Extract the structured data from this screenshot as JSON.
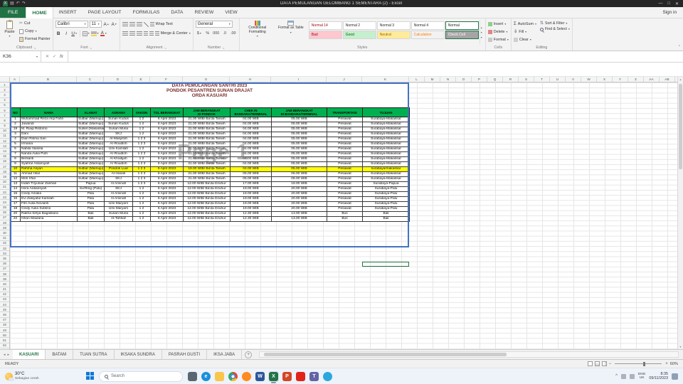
{
  "colors": {
    "excel_green": "#217346",
    "table_header_green": "#00b050",
    "row_highlight": "#ffff00",
    "page_break_blue": "#4472c4",
    "title_text": "#7b2c2c",
    "taskbar_bg": "#eef2f9"
  },
  "glyphs": {
    "dropdown": "▾",
    "up": "▴",
    "bold": "B",
    "italic": "I",
    "underline": "U",
    "sigma": "Σ",
    "cut_icon": "✂",
    "check": "✓",
    "cross": "✕",
    "chevron_up": "^",
    "tab_left": "◂",
    "tab_right": "▸",
    "plus": "+",
    "minus": "−",
    "font_a": "A",
    "add_sheet": "+",
    "dialog_launcher": "↘",
    "sort": "⇅",
    "fill_arrow": "⇓",
    "minimize": "—",
    "maximize": "□",
    "undo": "↶",
    "redo": "↷",
    "save": "▤"
  },
  "window": {
    "title": "DATA PEMULANGAN GELOMBANG 1 SEMENTARA (2) - Excel",
    "sign_in": "Sign in",
    "logo_letter": "X"
  },
  "ribbon": {
    "tabs": [
      {
        "label": "FILE",
        "type": "file"
      },
      {
        "label": "HOME",
        "type": "active"
      },
      {
        "label": "INSERT",
        "type": "normal"
      },
      {
        "label": "PAGE LAYOUT",
        "type": "normal"
      },
      {
        "label": "FORMULAS",
        "type": "normal"
      },
      {
        "label": "DATA",
        "type": "normal"
      },
      {
        "label": "REVIEW",
        "type": "normal"
      },
      {
        "label": "VIEW",
        "type": "normal"
      }
    ],
    "clipboard": {
      "label": "Clipboard",
      "paste": "Paste",
      "cut": "Cut",
      "copy": "Copy",
      "format_painter": "Format Painter"
    },
    "font": {
      "label": "Font",
      "family": "Calibri",
      "size": "11"
    },
    "alignment": {
      "label": "Alignment",
      "wrap_text": "Wrap Text",
      "merge_center": "Merge & Center"
    },
    "number": {
      "label": "Number",
      "format": "General",
      "accounting": "$",
      "percent": "%",
      "comma": "000",
      "inc_decimal": ".0",
      "dec_decimal": ".00"
    },
    "styles": {
      "label": "Styles",
      "conditional_formatting": "Conditional Formatting",
      "format_as_table": "Format as Table",
      "items": [
        {
          "label": "Normal 14",
          "bg": "#ffffff",
          "fg": "#9c0006",
          "selected": false
        },
        {
          "label": "Normal 2",
          "bg": "#ffffff",
          "fg": "#1f1f1f",
          "selected": false
        },
        {
          "label": "Normal 3",
          "bg": "#ffffff",
          "fg": "#1f1f1f",
          "selected": false
        },
        {
          "label": "Normal 4",
          "bg": "#ffffff",
          "fg": "#1f1f1f",
          "selected": false
        },
        {
          "label": "Normal",
          "bg": "#ffffff",
          "fg": "#1f1f1f",
          "selected": true
        },
        {
          "label": "Bad",
          "bg": "#ffc7ce",
          "fg": "#9c0006",
          "selected": false
        },
        {
          "label": "Good",
          "bg": "#c6efce",
          "fg": "#006100",
          "selected": false
        },
        {
          "label": "Neutral",
          "bg": "#ffeb9c",
          "fg": "#9c6500",
          "selected": false
        },
        {
          "label": "Calculation",
          "bg": "#f2f2f2",
          "fg": "#fa7d00",
          "selected": false
        },
        {
          "label": "Check Cell",
          "bg": "#a5a5a5",
          "fg": "#ffffff",
          "selected": true
        }
      ]
    },
    "cells": {
      "label": "Cells",
      "insert": "Insert",
      "delete": "Delete",
      "format": "Format"
    },
    "editing": {
      "label": "Editing",
      "autosum": "AutoSum",
      "fill": "Fill",
      "clear": "Clear",
      "sort_filter": "Sort & Filter",
      "find_select": "Find & Select"
    }
  },
  "formula_bar": {
    "name_box": "K36",
    "fx": "fx"
  },
  "sheet": {
    "title_lines": [
      "DATA PEMULANGAN SANTRI 2023",
      "PONDOK PESANTREN SUNAN DRAJAT",
      "ORDA KASUARI"
    ],
    "watermark": "Page 1",
    "col_letters": [
      "A",
      "B",
      "C",
      "D",
      "E",
      "F",
      "G",
      "H",
      "I",
      "J",
      "K",
      "L",
      "M",
      "N",
      "O",
      "P",
      "Q",
      "R",
      "S",
      "T",
      "U",
      "V",
      "W",
      "X",
      "Y",
      "Z",
      "AA",
      "AB"
    ],
    "row_count": 52,
    "table": {
      "headers": [
        "NO",
        "NAMA",
        "ALAMAT",
        "ASRAMA",
        "VAKSIN",
        "TGL BERANGKAT",
        "JAM BERANGKAT\nDI PONDOK",
        "CHEK IN\nBANDARA/TERMINAL",
        "JAM BERANGKAT\nDI BANDARA/TERMINAL",
        "TRANSPORTASI",
        "TUJUAN"
      ],
      "rows": [
        {
          "highlight": false,
          "cells": [
            "1",
            "Muhammad Reza Alqi Fahri",
            "Sulbar (Mamuju)",
            "Sunan Kudus",
            "1 2",
            "6 April 2023",
            "21.00 WIB/ Ba'da Tarwih",
            "04.00 WIB",
            "05.00 WIB",
            "Pesawat",
            "Surabaya-Makassar"
          ]
        },
        {
          "highlight": false,
          "cells": [
            "2",
            "Jawandi",
            "Sulbar (Mamuju)",
            "Sunan Kudus",
            "1 2",
            "6 April 2023",
            "21.00 WIB/ Ba'da Tarwih",
            "04.00 WIB",
            "05.00 WIB",
            "Pesawat",
            "Surabaya-Makassar"
          ]
        },
        {
          "highlight": false,
          "cells": [
            "19",
            "M. Riaqi Ristomo",
            "Sulsel (Makassar)",
            "Sunan Muria",
            "1 2",
            "6 April 2023",
            "21.00 WIB/ Ba'da Tarwih",
            "04.00 WIB",
            "05.00 WIB",
            "Pesawat",
            "Surabaya-Makassar"
          ]
        },
        {
          "highlight": false,
          "cells": [
            "3",
            "Dani",
            "Sulbar (Mamuju)",
            "SKJ",
            "1 2",
            "6 April 2023",
            "21.00 WIB/ Ba'da Tarwih",
            "04.00 WIB",
            "05.00 WIB",
            "Pesawat",
            "Surabaya-Makassar"
          ]
        },
        {
          "highlight": false,
          "cells": [
            "4",
            "Dian Risma Sari",
            "Sulbar (Mamuju)",
            "Al-Masyitoh",
            "1 2 3",
            "6 April 2023",
            "21.00 WIB/ Ba'da Tarwih",
            "04.00 WIB",
            "05.00 WIB",
            "Pesawat",
            "Surabaya-Makassar"
          ]
        },
        {
          "highlight": false,
          "cells": [
            "5",
            "Irmania",
            "Sulbar (Mamuju)",
            "Ar-Roudloh",
            "1 2 3",
            "6 April 2023",
            "21.00 WIB/ Ba'da Tarwih",
            "04.00 WIB",
            "05.00 WIB",
            "Pesawat",
            "Surabaya-Makassar"
          ]
        },
        {
          "highlight": false,
          "cells": [
            "6",
            "Nabila Vaisela",
            "Sulbar (Mamuju)",
            "Umi Kamilah",
            "1 2",
            "6 April 2023",
            "21.00 WIB/ Ba'da Tarwih",
            "04.00 WIB",
            "05.00 WIB",
            "Pesawat",
            "Surabaya-Makassar"
          ]
        },
        {
          "highlight": false,
          "cells": [
            "7",
            "Nanda Aulia Putri",
            "Sulbar (Mamuju)",
            "Ar-Roudloh",
            "1 2 3",
            "6 April 2023",
            "21.00 WIB/ Ba'da Tarwih",
            "04.00 WIB",
            "05.00 WIB",
            "Pesawat",
            "Surabaya-Makassar"
          ]
        },
        {
          "highlight": false,
          "cells": [
            "8",
            "Berlianti",
            "Sulbar (Mamuju)",
            "Al Khodijah",
            "1 2",
            "6 April 2023",
            "21.00 WIB/ Ba'da Tarwih",
            "04.00 WIB",
            "05.00 WIB",
            "Pesawat",
            "Surabaya-Makassar"
          ]
        },
        {
          "highlight": false,
          "cells": [
            "9",
            "Syahrul Aslamiyah",
            "Sulbar (Mamuju)",
            "Ar Roudloh",
            "1 2 3",
            "6 April 2023",
            "21.00 WIB/ Ba'da Tarwih",
            "04.00 WIB",
            "05.00 WIB",
            "Pesawat",
            "Surabaya-Makassar"
          ]
        },
        {
          "highlight": true,
          "cells": [
            "10",
            "Rahma Asyari",
            "Sulbar (Mamuju)",
            "Pondok Luar",
            "1 2 3",
            "6 April 2023",
            "19.00 WIB/ Ba'da Tarwih",
            "04.00 WIB",
            "05.00 WIB",
            "Pesawat",
            "surabaya/makassar"
          ]
        },
        {
          "highlight": false,
          "cells": [
            "11",
            "Ahmad Hilal",
            "Sulbar (Mamuju)",
            "Al-Hanafi",
            "1 2 3",
            "6 April 2023",
            "21.00 WIB/ Ba'da Tarwih",
            "05.00 WIB",
            "06.00 WIB",
            "Pesawat",
            "Surabaya-Makassar"
          ]
        },
        {
          "highlight": false,
          "cells": [
            "12",
            "Moh Irfan",
            "Sulbar (Mamuju)",
            "SKJ",
            "1 2 3",
            "6 April 2023",
            "21.00 WIB/ Ba'da Tarwih",
            "05.00 WIB",
            "08.00 WIB",
            "Pesawat",
            "Surabaya-Makassar"
          ]
        },
        {
          "highlight": false,
          "cells": [
            "13",
            "Indah Triyuniar Zanhari",
            "Papua",
            "Al Aminah",
            "1 2 3",
            "6 April 2023",
            "12.00 WIB/ Ba'da Dzuhur",
            "17.00 WIB",
            "18.00 WIB",
            "Pesawat",
            "Surabaya-Papua"
          ]
        },
        {
          "highlight": false,
          "cells": [
            "14",
            "Hera Ardiansyah",
            "SulTeng (Palu)",
            "SKJ",
            "1 2",
            "6 April 2023",
            "12.00 WIB/ Ba'da Dzuhur",
            "19.00 WIB",
            "20.00 WIB",
            "Pesawat",
            "Surabaya-Palu"
          ]
        },
        {
          "highlight": false,
          "cells": [
            "15",
            "Cindy Amalia",
            "Palu",
            "Al Aminah",
            "1 2",
            "6 April 2023",
            "12.00 WIB/ Ba'da Dzuhur",
            "19.00 WIB",
            "20.00 WIB",
            "Pesawat",
            "Surabaya-Palu"
          ]
        },
        {
          "highlight": false,
          "cells": [
            "16",
            "Evi Zakiyatul Kamilah",
            "Palu",
            "Al Aminah",
            "1 2",
            "6 April 2023",
            "12.00 WIB/ Ba'da Dzuhur",
            "19.00 WIB",
            "20.00 WIB",
            "Pesawat",
            "Surabaya-Palu"
          ]
        },
        {
          "highlight": false,
          "cells": [
            "17",
            "Fitri Aulia Novianti",
            "Palu",
            "Umi Maryam",
            "1 2",
            "6 April 2023",
            "12.00 WIB/ Ba'da Dzuhur",
            "19.00 WIB",
            "20.00 WIB",
            "Pesawat",
            "Surabaya-Palu"
          ]
        },
        {
          "highlight": false,
          "cells": [
            "18",
            "Cindy Aulia Sutikno",
            "Palu",
            "Umi Maryam",
            "1 2",
            "6 April 2023",
            "12.00 WIB/ Ba'da Dzuhur",
            "19.00 WIB",
            "20.00 WIB",
            "Pesawat",
            "Surabaya-Palu"
          ]
        },
        {
          "highlight": false,
          "cells": [
            "20",
            "Rakha Setya Bagaskara",
            "Bali",
            "Sunan Muria",
            "1 2",
            "6 April 2023",
            "12.00 WIB/ Ba'da Dzuhur",
            "12.30 WIB",
            "13.00 WIB",
            "Bus",
            "Bali"
          ]
        },
        {
          "highlight": false,
          "cells": [
            "22",
            "Ishan Maulana",
            "Bali",
            "At-Tahfidz",
            "1 2",
            "6 April 2023",
            "12.00 WIB/ Ba'da Dzuhur",
            "12.30 WIB",
            "13.00 WIB",
            "Bus",
            "Bali"
          ]
        }
      ]
    }
  },
  "sheet_tabs": {
    "tabs": [
      {
        "label": "KASUARI",
        "active": true
      },
      {
        "label": "BATAM",
        "active": false
      },
      {
        "label": "TUAN SUTRA",
        "active": false
      },
      {
        "label": "IKSAKA SUNDRA",
        "active": false
      },
      {
        "label": "PASRAH GUSTI",
        "active": false
      },
      {
        "label": "IKSA JABA",
        "active": false
      }
    ]
  },
  "status_bar": {
    "mode": "READY",
    "zoom": "60%"
  },
  "taskbar": {
    "weather_temp": "30°C",
    "weather_desc": "Sebagian cerah",
    "search": "Search",
    "apps": [
      {
        "name": "task-view-icon",
        "color": "#5b6770",
        "label": "",
        "shape": "square",
        "active": false
      },
      {
        "name": "edge-icon",
        "color": "#1b90d8",
        "label": "e",
        "shape": "circle",
        "active": false
      },
      {
        "name": "file-explorer-icon",
        "color": "#f8c64a",
        "label": "",
        "shape": "square",
        "active": false
      },
      {
        "name": "chrome-icon",
        "color": "chrome",
        "label": "",
        "shape": "circle",
        "active": false
      },
      {
        "name": "firefox-icon",
        "color": "#ff8a1e",
        "label": "",
        "shape": "circle",
        "active": false
      },
      {
        "name": "word-icon",
        "color": "#2b579a",
        "label": "W",
        "shape": "square",
        "active": false
      },
      {
        "name": "excel-icon",
        "color": "#217346",
        "label": "X",
        "shape": "square",
        "active": true
      },
      {
        "name": "powerpoint-icon",
        "color": "#d24726",
        "label": "P",
        "shape": "square",
        "active": false
      },
      {
        "name": "acrobat-icon",
        "color": "#e2231a",
        "label": "",
        "shape": "square",
        "active": false
      },
      {
        "name": "teams-icon",
        "color": "#6264a7",
        "label": "T",
        "shape": "square",
        "active": false
      },
      {
        "name": "telegram-icon",
        "color": "#2aa7de",
        "label": "",
        "shape": "circle",
        "active": false
      }
    ],
    "tray": {
      "lang_line1": "ENG",
      "lang_line2": "UK",
      "time": "8:35",
      "date": "09/11/2023"
    }
  }
}
